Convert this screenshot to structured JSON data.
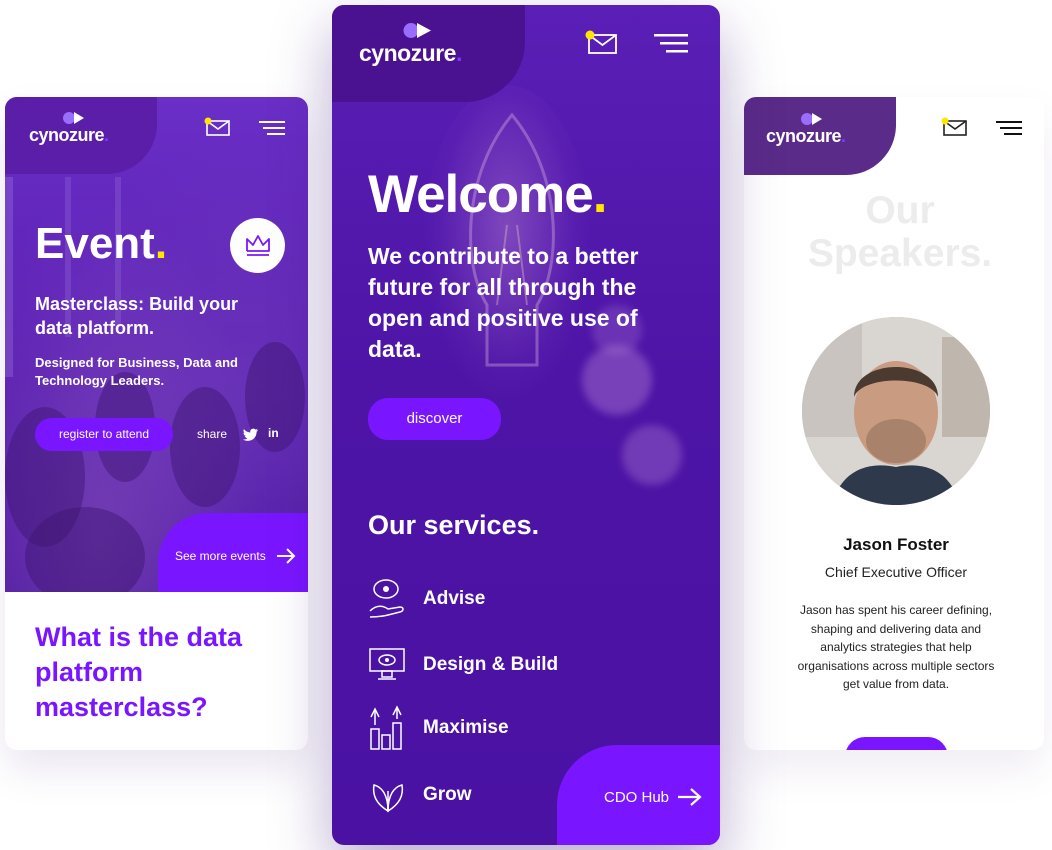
{
  "brand": {
    "logo_text": "cynozure",
    "logo_dot": ".",
    "accent": "#7a16ff",
    "highlight": "#ffe600"
  },
  "left_phone": {
    "event_title": "Event",
    "event_title_dot": ".",
    "masterclass_title": "Masterclass: Build your data platform.",
    "subtitle": "Designed for Business, Data and Technology Leaders.",
    "register_button": "register to attend",
    "share_label": "share",
    "share_linkedin": "in",
    "see_more_button": "See more events",
    "question": "What is the data platform masterclass?"
  },
  "center_phone": {
    "welcome_title": "Welcome",
    "welcome_dot": ".",
    "tagline": "We contribute to a better future for all through the open and positive use of data.",
    "discover_button": "discover",
    "services_title": "Our services.",
    "services": [
      {
        "label": "Advise",
        "icon": "hand-eye-icon"
      },
      {
        "label": "Design & Build",
        "icon": "monitor-eye-icon"
      },
      {
        "label": "Maximise",
        "icon": "growth-bars-icon"
      },
      {
        "label": "Grow",
        "icon": "leaves-icon"
      }
    ],
    "footer_button": "CDO Hub"
  },
  "right_phone": {
    "speakers_title": "Our Speakers.",
    "speaker_name": "Jason Foster",
    "speaker_role": "Chief Executive Officer",
    "speaker_bio": "Jason has spent his career defining, shaping and delivering data and analytics strategies that help organisations across multiple sectors get value from data."
  }
}
